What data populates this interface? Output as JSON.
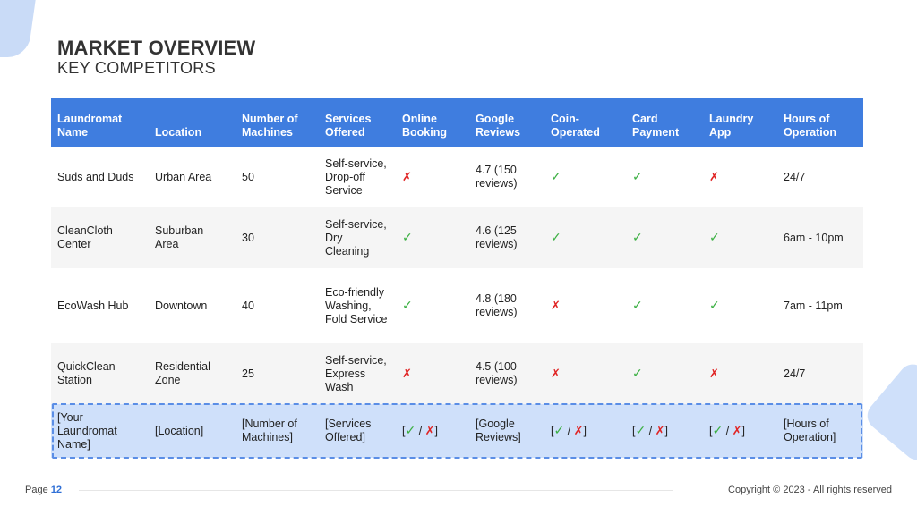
{
  "header": {
    "title": "MARKET OVERVIEW",
    "subtitle": "KEY COMPETITORS"
  },
  "table": {
    "columns": [
      "Laundromat Name",
      "Location",
      "Number of Machines",
      "Services Offered",
      "Online Booking",
      "Google Reviews",
      "Coin-Operated",
      "Card Payment",
      "Laundry App",
      "Hours of Operation"
    ],
    "rows": [
      {
        "name": "Suds and Duds",
        "location": "Urban Area",
        "machines": "50",
        "services": "Self-service, Drop-off Service",
        "online_booking": "✗",
        "reviews": "4.7 (150 reviews)",
        "coin": "✓",
        "card": "✓",
        "app": "✗",
        "hours": "24/7"
      },
      {
        "name": "CleanCloth Center",
        "location": "Suburban Area",
        "machines": "30",
        "services": "Self-service, Dry Cleaning",
        "online_booking": "✓",
        "reviews": "4.6 (125 reviews)",
        "coin": "✓",
        "card": "✓",
        "app": "✓",
        "hours": "6am - 10pm"
      },
      {
        "name": "EcoWash Hub",
        "location": "Downtown",
        "machines": "40",
        "services": "Eco-friendly Washing, Fold Service",
        "online_booking": "✓",
        "reviews": "4.8 (180 reviews)",
        "coin": "✗",
        "card": "✓",
        "app": "✓",
        "hours": "7am - 11pm"
      },
      {
        "name": "QuickClean Station",
        "location": "Residential Zone",
        "machines": "25",
        "services": "Self-service, Express Wash",
        "online_booking": "✗",
        "reviews": "4.5 (100 reviews)",
        "coin": "✗",
        "card": "✓",
        "app": "✗",
        "hours": "24/7"
      }
    ],
    "template_row": {
      "name": "[Your Laundromat Name]",
      "location": "[Location]",
      "machines": "[Number of Machines]",
      "services": "[Services Offered]",
      "online_booking": {
        "open": "[",
        "yes": "✓",
        "sep": " / ",
        "no": "✗",
        "close": "]"
      },
      "reviews": "[Google Reviews]",
      "coin": {
        "open": "[",
        "yes": "✓",
        "sep": " / ",
        "no": "✗",
        "close": "]"
      },
      "card": {
        "open": "[",
        "yes": "✓",
        "sep": " / ",
        "no": "✗",
        "close": "]"
      },
      "app": {
        "open": "[",
        "yes": "✓",
        "sep": " / ",
        "no": "✗",
        "close": "]"
      },
      "hours": "[Hours of Operation]"
    }
  },
  "footer": {
    "page_label": "Page",
    "page_number": "12",
    "copyright": "Copyright © 2023 - All rights reserved"
  },
  "colors": {
    "header_bg": "#3f7ddf",
    "check": "#3cb043",
    "cross": "#e02424",
    "highlight_row": "#cfe0fa"
  }
}
